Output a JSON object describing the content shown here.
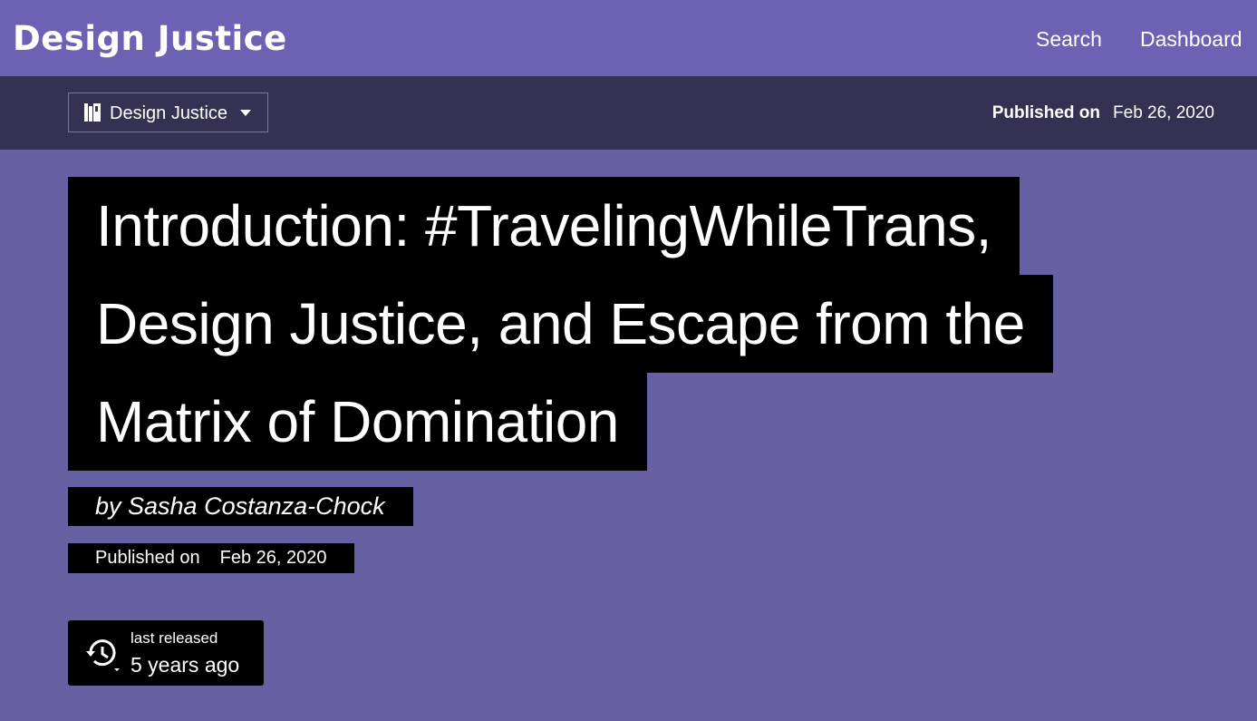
{
  "header": {
    "brand": "Design Justice",
    "nav": [
      {
        "label": "Search"
      },
      {
        "label": "Dashboard"
      }
    ]
  },
  "subheader": {
    "collection": {
      "label": "Design Justice",
      "icon": "book-icon"
    },
    "published_label": "Published on",
    "published_date": "Feb 26, 2020"
  },
  "article": {
    "title_lines": [
      "Introduction: #TravelingWhileTrans,",
      "Design Justice, and Escape from the",
      "Matrix of Domination"
    ],
    "byline": "by Sasha Costanza-Chock",
    "published_label": "Published on",
    "published_date": "Feb 26, 2020"
  },
  "release": {
    "icon": "history-icon",
    "label": "last released",
    "value": "5 years ago"
  },
  "colors": {
    "header_bg": "#6c62b4",
    "subheader_bg": "#353152",
    "page_bg": "#6761a3",
    "block_bg": "#000000",
    "text": "#ffffff"
  }
}
